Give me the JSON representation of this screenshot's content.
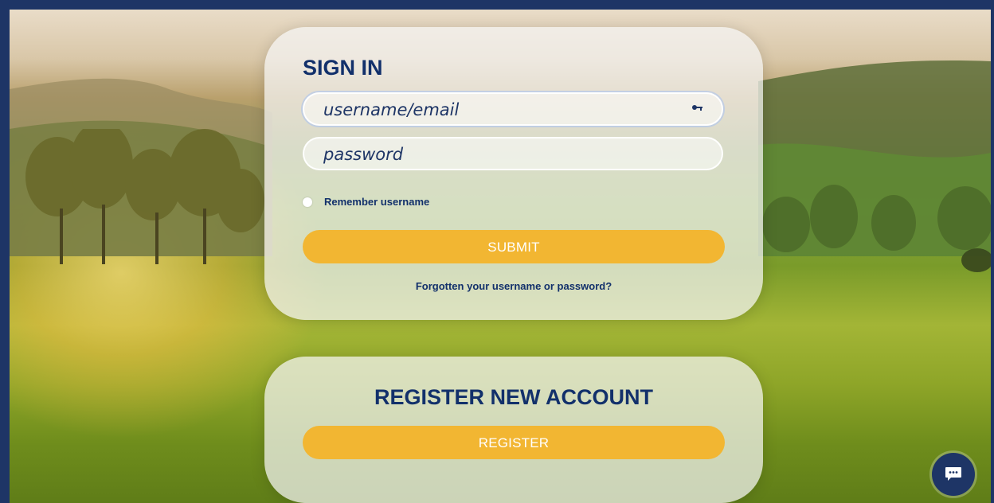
{
  "signin": {
    "title": "SIGN IN",
    "username_placeholder": "username/email",
    "password_placeholder": "password",
    "remember_label": "Remember username",
    "remember_checked": false,
    "submit_label": "SUBMIT",
    "forgot_label": "Forgotten your username or password?"
  },
  "register": {
    "title": "REGISTER NEW ACCOUNT",
    "button_label": "REGISTER"
  },
  "icons": {
    "username_field": "key-icon",
    "chat": "chat-bubble-icon"
  },
  "colors": {
    "brand_navy": "#12306b",
    "accent_yellow": "#f2b632",
    "frame": "#1e3566"
  }
}
